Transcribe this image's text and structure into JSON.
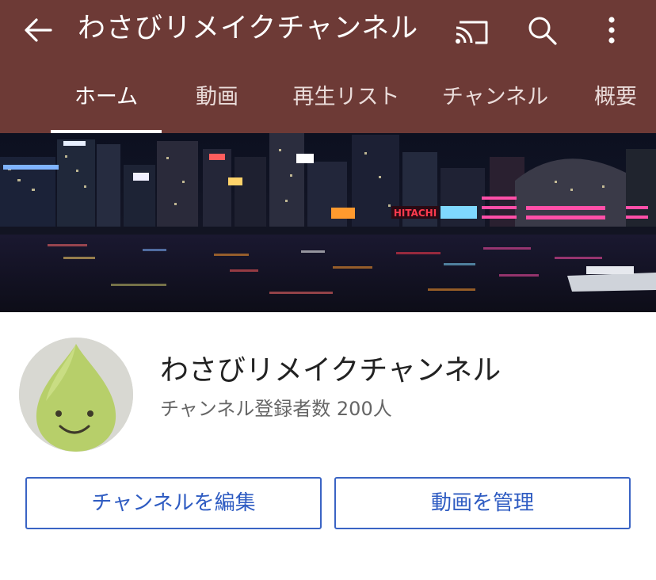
{
  "header": {
    "title": "わさびリメイクチャンネル",
    "back_icon": "arrow-left-icon",
    "cast_icon": "cast-icon",
    "search_icon": "search-icon",
    "more_icon": "more-vertical-icon",
    "background_color": "#6d3a36"
  },
  "tabs": [
    {
      "label": "ホーム",
      "selected": true
    },
    {
      "label": "動画",
      "selected": false
    },
    {
      "label": "再生リスト",
      "selected": false
    },
    {
      "label": "チャンネル",
      "selected": false
    },
    {
      "label": "概要",
      "selected": false
    }
  ],
  "banner": {
    "sign_text": "HITACHI"
  },
  "channel": {
    "name": "わさびリメイクチャンネル",
    "subscribers": "チャンネル登録者数 200人"
  },
  "buttons": {
    "edit_label": "チャンネルを編集",
    "manage_label": "動画を管理",
    "accent_color": "#2f5cc2"
  }
}
